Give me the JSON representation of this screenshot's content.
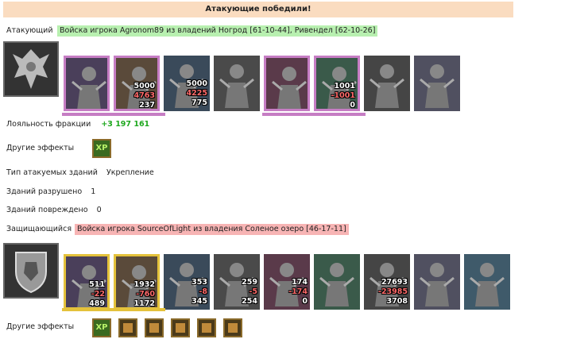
{
  "banner": "Атакующие победили!",
  "attacker": {
    "label": "Атакующий",
    "army": "Войска игрока Agronom89 из владений Ногрод [61-10-44], Ривендел [62-10-26]",
    "portrait_icon": "dragon-emblem-icon",
    "units": [
      {
        "icon": "dark-knight-icon",
        "style": "hero-a",
        "counts": []
      },
      {
        "icon": "swordsman-icon",
        "style": "hero-a",
        "counts": [
          "5000",
          "4763",
          "237"
        ]
      },
      {
        "icon": "knight-icon",
        "style": "plain",
        "counts": [
          "5000",
          "4225",
          "775"
        ]
      },
      {
        "icon": "wolf-rider-icon",
        "style": "plain",
        "counts": []
      },
      {
        "icon": "archer-icon",
        "style": "hero-a",
        "counts": []
      },
      {
        "icon": "sorceress-icon",
        "style": "hero-a",
        "counts": [
          "1001",
          "-1001",
          "0"
        ]
      },
      {
        "icon": "shadow-knight-icon",
        "style": "plain",
        "counts": []
      },
      {
        "icon": "black-rider-icon",
        "style": "plain",
        "counts": []
      }
    ],
    "loyalty_label": "Лояльность фракции",
    "loyalty_value": "+3 197 161",
    "effects_label": "Другие эффекты",
    "effects": [
      {
        "icon": "xp-icon",
        "text": "XP"
      }
    ],
    "building_type_label": "Тип атакуемых зданий",
    "building_type_value": "Укрепление",
    "destroyed_label": "Зданий разрушено",
    "destroyed_value": "1",
    "damaged_label": "Зданий повреждено",
    "damaged_value": "0"
  },
  "defender": {
    "label": "Защищающийся",
    "army": "Войска игрока SourceOfLight из владения Соленое озеро [46-17-11]",
    "portrait_icon": "lion-shield-icon",
    "units": [
      {
        "icon": "royal-guard-icon",
        "style": "hero-d",
        "counts": [
          "511",
          "-22",
          "489"
        ]
      },
      {
        "icon": "paladin-icon",
        "style": "hero-d",
        "counts": [
          "1932",
          "-760",
          "1172"
        ]
      },
      {
        "icon": "cavalry-icon",
        "style": "plain",
        "counts": [
          "353",
          "-8",
          "345"
        ]
      },
      {
        "icon": "griffin-icon",
        "style": "plain",
        "counts": [
          "259",
          "-5",
          "254"
        ]
      },
      {
        "icon": "crossbowman-icon",
        "style": "plain",
        "counts": [
          "174",
          "-174",
          "0"
        ]
      },
      {
        "icon": "hooded-figure-icon",
        "style": "plain",
        "counts": []
      },
      {
        "icon": "footman-icon",
        "style": "plain",
        "counts": [
          "27693",
          "-23985",
          "3708"
        ]
      },
      {
        "icon": "reaper-icon",
        "style": "plain",
        "counts": []
      },
      {
        "icon": "tower-icon",
        "style": "plain",
        "counts": []
      }
    ],
    "effects_label": "Другие эффекты",
    "effects": [
      {
        "icon": "xp-icon",
        "text": "XP"
      },
      {
        "icon": "fire-boot-icon",
        "text": ""
      },
      {
        "icon": "shield-icon",
        "text": ""
      },
      {
        "icon": "elixir-icon",
        "text": ""
      },
      {
        "icon": "fortress-icon",
        "text": ""
      },
      {
        "icon": "axe-icon",
        "text": ""
      }
    ]
  },
  "colors": {
    "banner_bg": "#fadcc0",
    "attacker_pill": "#b8f0b0",
    "defender_pill": "#f7b4b4",
    "gain": "#1fa81f",
    "loss": "#ff6a6a"
  }
}
